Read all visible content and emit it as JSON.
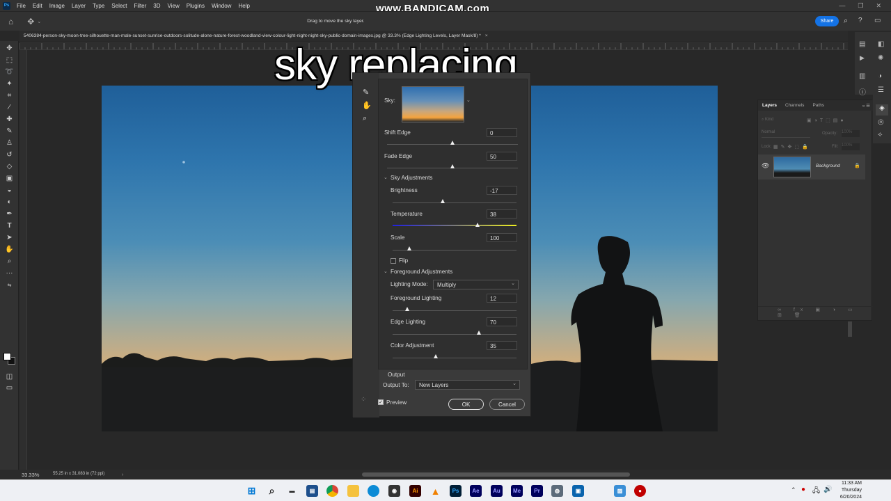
{
  "menu": {
    "items": [
      "File",
      "Edit",
      "Image",
      "Layer",
      "Type",
      "Select",
      "Filter",
      "3D",
      "View",
      "Plugins",
      "Window",
      "Help"
    ]
  },
  "options": {
    "hint": "Drag to move the sky layer.",
    "share": "Share"
  },
  "document": {
    "tab_title": "5406384-person-sky-moon-tree-silhouette-man-male-sunset-sunrise-outdoors-solitude-alone-nature-forest-woodland-view-colour-light-night-night-sky-public-domain-images.jpg @ 33.3% (Edge Lighting Levels, Layer Mask/8) *"
  },
  "overlay": {
    "title": "sky replacing",
    "watermark": "www.BANDICAM.com"
  },
  "dialog": {
    "sky_label": "Sky:",
    "shift_edge": {
      "label": "Shift Edge",
      "value": "0",
      "pos": 0.5
    },
    "fade_edge": {
      "label": "Fade Edge",
      "value": "50",
      "pos": 0.5
    },
    "sky_adjustments": "Sky Adjustments",
    "brightness": {
      "label": "Brightness",
      "value": "-17",
      "pos": 0.41
    },
    "temperature": {
      "label": "Temperature",
      "value": "38",
      "pos": 0.69
    },
    "scale": {
      "label": "Scale",
      "value": "100",
      "pos": 0.14
    },
    "flip": "Flip",
    "foreground_adjustments": "Foreground Adjustments",
    "lighting_mode_label": "Lighting Mode:",
    "lighting_mode_value": "Multiply",
    "foreground_lighting": {
      "label": "Foreground Lighting",
      "value": "12",
      "pos": 0.12
    },
    "edge_lighting": {
      "label": "Edge Lighting",
      "value": "70",
      "pos": 0.7
    },
    "color_adjustment": {
      "label": "Color Adjustment",
      "value": "35",
      "pos": 0.35
    },
    "output_heading": "Output",
    "output_to_label": "Output To:",
    "output_to_value": "New Layers",
    "preview": "Preview",
    "ok": "OK",
    "cancel": "Cancel"
  },
  "layers": {
    "tabs": [
      "Layers",
      "Channels",
      "Paths"
    ],
    "kind": "Kind",
    "blend": "Normal",
    "opacity_label": "Opacity:",
    "lock_label": "Lock:",
    "fill_label": "Fill:",
    "layer_name": "Background"
  },
  "status": {
    "zoom": "33.33%",
    "size": "55.25 in x 31.083 in (72 ppi)"
  },
  "clock": {
    "time": "11:33 AM",
    "day": "Thursday",
    "date": "6/20/2024"
  },
  "colors": {
    "accent": "#1473e6",
    "sky_top": "#1f5f99",
    "sunset": "#f1aa56"
  }
}
